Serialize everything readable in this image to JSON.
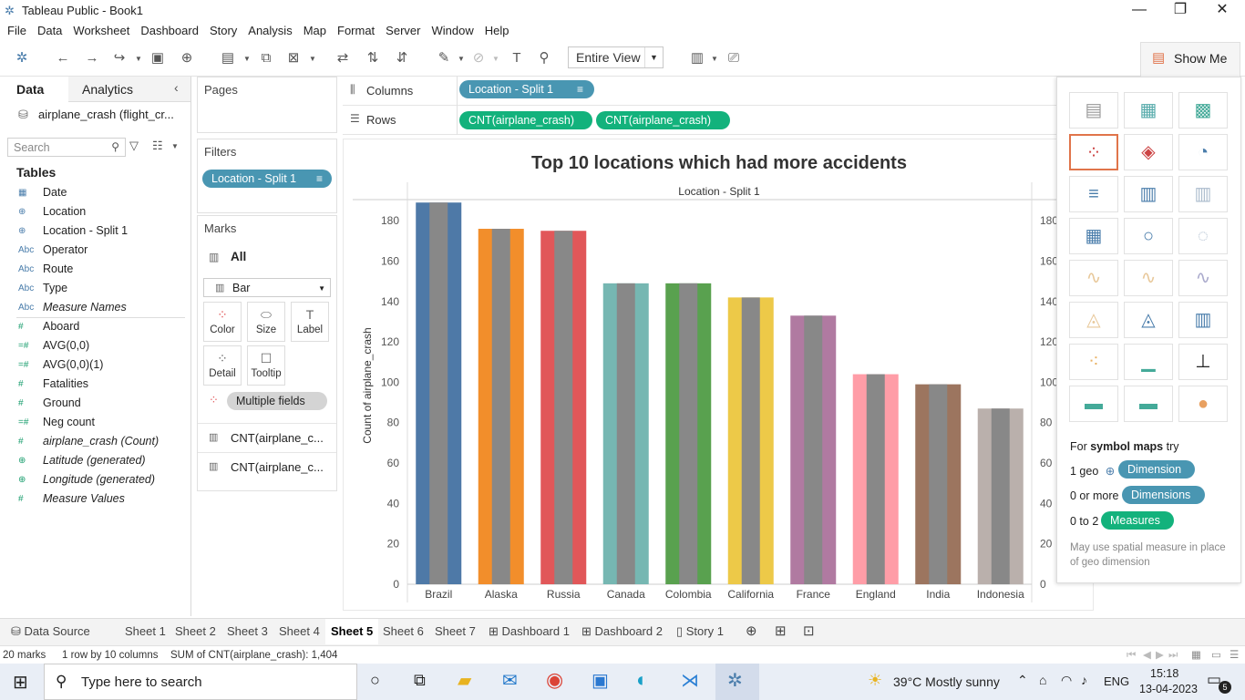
{
  "window": {
    "title": "Tableau Public - Book1"
  },
  "menu": [
    "File",
    "Data",
    "Worksheet",
    "Dashboard",
    "Story",
    "Analysis",
    "Map",
    "Format",
    "Server",
    "Window",
    "Help"
  ],
  "toolbar": {
    "view_select": "Entire View",
    "show_me_label": "Show Me"
  },
  "data_pane": {
    "tab_data": "Data",
    "tab_analytics": "Analytics",
    "datasource": "airplane_crash (flight_cr...",
    "search_placeholder": "Search",
    "tables_heading": "Tables",
    "fields": [
      {
        "icon": "calendar-icon",
        "glyph": "▦",
        "name": "Date",
        "measure": false,
        "italic": false
      },
      {
        "icon": "globe-icon",
        "glyph": "⊕",
        "name": "Location",
        "measure": false,
        "italic": false
      },
      {
        "icon": "globe-icon",
        "glyph": "⊕",
        "name": "Location - Split 1",
        "measure": false,
        "italic": false
      },
      {
        "icon": "abc-icon",
        "glyph": "Abc",
        "name": "Operator",
        "measure": false,
        "italic": false
      },
      {
        "icon": "abc-icon",
        "glyph": "Abc",
        "name": "Route",
        "measure": false,
        "italic": false
      },
      {
        "icon": "abc-icon",
        "glyph": "Abc",
        "name": "Type",
        "measure": false,
        "italic": false
      },
      {
        "icon": "abc-icon",
        "glyph": "Abc",
        "name": "Measure Names",
        "measure": false,
        "italic": true
      },
      {
        "icon": "hash-icon",
        "glyph": "#",
        "name": "Aboard",
        "measure": true,
        "italic": false
      },
      {
        "icon": "hash-icon",
        "glyph": "=#",
        "name": "AVG(0,0)",
        "measure": true,
        "italic": false
      },
      {
        "icon": "hash-icon",
        "glyph": "=#",
        "name": "AVG(0,0)(1)",
        "measure": true,
        "italic": false
      },
      {
        "icon": "hash-icon",
        "glyph": "#",
        "name": "Fatalities",
        "measure": true,
        "italic": false
      },
      {
        "icon": "hash-icon",
        "glyph": "#",
        "name": "Ground",
        "measure": true,
        "italic": false
      },
      {
        "icon": "hash-icon",
        "glyph": "=#",
        "name": "Neg count",
        "measure": true,
        "italic": false
      },
      {
        "icon": "hash-icon",
        "glyph": "#",
        "name": "airplane_crash (Count)",
        "measure": true,
        "italic": true
      },
      {
        "icon": "globe-icon",
        "glyph": "⊕",
        "name": "Latitude (generated)",
        "measure": true,
        "italic": true
      },
      {
        "icon": "globe-icon",
        "glyph": "⊕",
        "name": "Longitude (generated)",
        "measure": true,
        "italic": true
      },
      {
        "icon": "hash-icon",
        "glyph": "#",
        "name": "Measure Values",
        "measure": true,
        "italic": true
      }
    ]
  },
  "cards": {
    "pages_title": "Pages",
    "filters_title": "Filters",
    "filter_pill": "Location - Split 1",
    "marks_title": "Marks",
    "marks_all": "All",
    "mark_type": "Bar",
    "buttons": {
      "color": "Color",
      "size": "Size",
      "label": "Label",
      "detail": "Detail",
      "tooltip": "Tooltip"
    },
    "multiple_fields": "Multiple fields",
    "measure1": "CNT(airplane_c...",
    "measure2": "CNT(airplane_c..."
  },
  "shelves": {
    "columns_label": "Columns",
    "rows_label": "Rows",
    "columns_pill": "Location - Split 1",
    "rows_pill_1": "CNT(airplane_crash)",
    "rows_pill_2": "CNT(airplane_crash)"
  },
  "chart_data": {
    "type": "bar",
    "title": "Top 10 locations which had more accidents",
    "header": "Location - Split 1",
    "ylabel": "Count of airplane_crash",
    "ylim": [
      0,
      190
    ],
    "yticks": [
      0,
      20,
      40,
      60,
      80,
      100,
      120,
      140,
      160,
      180
    ],
    "categories": [
      "Brazil",
      "Alaska",
      "Russia",
      "Canada",
      "Colombia",
      "California",
      "France",
      "England",
      "India",
      "Indonesia"
    ],
    "values": [
      189,
      176,
      175,
      149,
      149,
      142,
      133,
      104,
      99,
      87
    ],
    "colors": [
      "#4e79a7",
      "#f28e2b",
      "#e15759",
      "#76b7b2",
      "#59a14f",
      "#edc948",
      "#b07aa1",
      "#ff9da7",
      "#9c755f",
      "#bab0ac"
    ],
    "overlay_color": "#888888"
  },
  "show_me": {
    "hint_prefix": "For ",
    "hint_bold": "symbol maps",
    "hint_suffix": " try",
    "rows": [
      {
        "label": "1 geo",
        "pill": "Dimension"
      },
      {
        "label": "0 or more",
        "pill": "Dimensions"
      },
      {
        "label": "0 to 2",
        "pill": "Measures"
      }
    ],
    "note": "May use spatial measure in place of geo dimension"
  },
  "sheet_tabs": [
    "Data Source",
    "Sheet 1",
    "Sheet 2",
    "Sheet 3",
    "Sheet 4",
    "Sheet 5",
    "Sheet 6",
    "Sheet 7",
    "Dashboard 1",
    "Dashboard 2",
    "Story 1"
  ],
  "active_tab": "Sheet 5",
  "status": {
    "marks": "20 marks",
    "layout": "1 row by 10 columns",
    "sum": "SUM of CNT(airplane_crash): 1,404"
  },
  "taskbar": {
    "search_placeholder": "Type here to search",
    "weather": "39°C  Mostly sunny",
    "lang": "ENG",
    "time": "15:18",
    "date": "13-04-2023",
    "notifications": "5"
  }
}
